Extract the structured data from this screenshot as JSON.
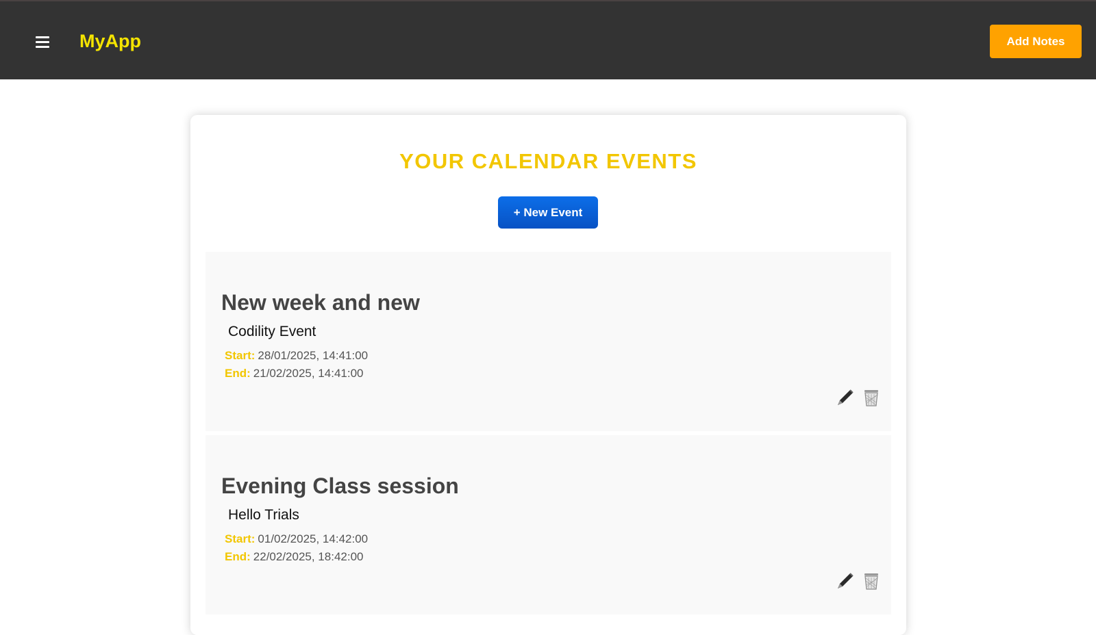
{
  "header": {
    "brand": "MyApp",
    "add_notes_label": "Add Notes"
  },
  "main": {
    "title": "YOUR CALENDAR EVENTS",
    "new_event_label": "+ New Event",
    "start_label": "Start:",
    "end_label": "End:",
    "events": [
      {
        "title": "New week and new",
        "description": "Codility Event",
        "start": "28/01/2025, 14:41:00",
        "end": "21/02/2025, 14:41:00"
      },
      {
        "title": "Evening Class session",
        "description": "Hello Trials",
        "start": "01/02/2025, 14:42:00",
        "end": "22/02/2025, 18:42:00"
      }
    ]
  },
  "icons": {
    "menu": "hamburger-menu-icon",
    "edit": "pencil-icon",
    "delete": "trash-icon"
  },
  "colors": {
    "topbar": "#333333",
    "brand": "#f5e400",
    "add_notes": "#ffa200",
    "title": "#f2c600",
    "new_event": "#0a63d8"
  }
}
